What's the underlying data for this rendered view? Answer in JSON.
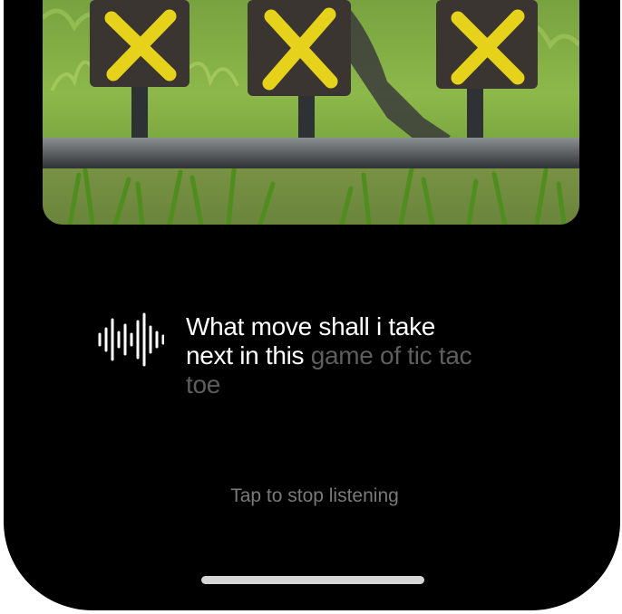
{
  "camera_preview": {
    "board_marks": [
      "X",
      "X",
      "X"
    ],
    "mark_color": "#e6d21a"
  },
  "listening": {
    "icon": "audio-waveform-icon",
    "transcript_spoken": "What move shall i take next in this",
    "transcript_pending": "game of tic tac toe",
    "stop_label": "Tap to stop listening"
  },
  "colors": {
    "background": "#000000",
    "text_primary": "#ffffff",
    "text_pending": "#5e5e5e",
    "hint_text": "#7a7a7a",
    "home_indicator": "#d6d6d6"
  }
}
